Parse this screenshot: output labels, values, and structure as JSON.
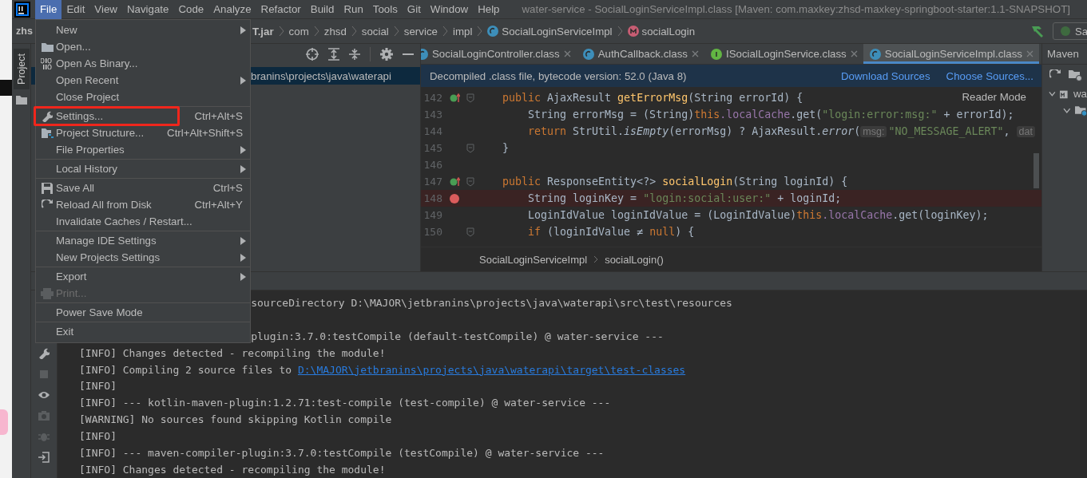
{
  "window": {
    "title": "water-service - SocialLoginServiceImpl.class [Maven: com.maxkey:zhsd-maxkey-springboot-starter:1.1-SNAPSHOT]"
  },
  "menu_bar": [
    {
      "label": "File",
      "selected": true
    },
    {
      "label": "Edit",
      "selected": false
    },
    {
      "label": "View",
      "selected": false
    },
    {
      "label": "Navigate",
      "selected": false
    },
    {
      "label": "Code",
      "selected": false
    },
    {
      "label": "Analyze",
      "selected": false
    },
    {
      "label": "Refactor",
      "selected": false
    },
    {
      "label": "Build",
      "selected": false
    },
    {
      "label": "Run",
      "selected": false
    },
    {
      "label": "Tools",
      "selected": false
    },
    {
      "label": "Git",
      "selected": false
    },
    {
      "label": "Window",
      "selected": false
    },
    {
      "label": "Help",
      "selected": false
    }
  ],
  "file_menu": {
    "groups": [
      [
        {
          "label": "New",
          "kind": "plain",
          "submenu": true,
          "disabled": false,
          "highlighted": false
        },
        {
          "label": "Open...",
          "kind": "folder",
          "submenu": false,
          "disabled": false,
          "highlighted": false
        },
        {
          "label": "Open As Binary...",
          "kind": "binary",
          "submenu": false,
          "disabled": false,
          "highlighted": false
        },
        {
          "label": "Open Recent",
          "kind": "plain",
          "submenu": true,
          "disabled": false,
          "highlighted": false
        },
        {
          "label": "Close Project",
          "kind": "plain",
          "submenu": false,
          "disabled": false,
          "highlighted": false
        }
      ],
      [
        {
          "label": "Settings...",
          "kind": "wrench",
          "shortcut": "Ctrl+Alt+S",
          "submenu": false,
          "disabled": false,
          "highlighted": true
        },
        {
          "label": "Project Structure...",
          "kind": "structure",
          "shortcut": "Ctrl+Alt+Shift+S",
          "submenu": false,
          "disabled": false,
          "highlighted": false
        },
        {
          "label": "File Properties",
          "kind": "plain",
          "submenu": true,
          "disabled": false,
          "highlighted": false
        }
      ],
      [
        {
          "label": "Local History",
          "kind": "plain",
          "submenu": true,
          "disabled": false,
          "highlighted": false
        }
      ],
      [
        {
          "label": "Save All",
          "kind": "save",
          "shortcut": "Ctrl+S",
          "submenu": false,
          "disabled": false,
          "highlighted": false
        },
        {
          "label": "Reload All from Disk",
          "kind": "reload",
          "shortcut": "Ctrl+Alt+Y",
          "submenu": false,
          "disabled": false,
          "highlighted": false
        },
        {
          "label": "Invalidate Caches / Restart...",
          "kind": "plain",
          "submenu": false,
          "disabled": false,
          "highlighted": false
        }
      ],
      [
        {
          "label": "Manage IDE Settings",
          "kind": "plain",
          "submenu": true,
          "disabled": false,
          "highlighted": false
        },
        {
          "label": "New Projects Settings",
          "kind": "plain",
          "submenu": true,
          "disabled": false,
          "highlighted": false
        }
      ],
      [
        {
          "label": "Export",
          "kind": "plain",
          "submenu": true,
          "disabled": false,
          "highlighted": false
        },
        {
          "label": "Print...",
          "kind": "print",
          "submenu": false,
          "disabled": true,
          "highlighted": false
        }
      ],
      [
        {
          "label": "Power Save Mode",
          "kind": "plain",
          "submenu": false,
          "disabled": false,
          "highlighted": false
        }
      ],
      [
        {
          "label": "Exit",
          "kind": "plain",
          "submenu": false,
          "disabled": false,
          "highlighted": false
        }
      ]
    ]
  },
  "navigation_bar": {
    "crumbs": [
      {
        "label": "zhs",
        "kind": "project"
      },
      {
        "label": "T.jar",
        "kind": "jar"
      },
      {
        "label": "com",
        "kind": "package"
      },
      {
        "label": "zhsd",
        "kind": "package"
      },
      {
        "label": "social",
        "kind": "package"
      },
      {
        "label": "service",
        "kind": "package"
      },
      {
        "label": "impl",
        "kind": "package"
      },
      {
        "label": "SocialLoginServiceImpl",
        "kind": "class"
      },
      {
        "label": "socialLogin",
        "kind": "method"
      }
    ],
    "run_button": "Sa"
  },
  "sidebar": {
    "tab": "Project"
  },
  "project_panel": {
    "selected_row": "branins\\projects\\java\\waterapi"
  },
  "editor": {
    "tabs": [
      {
        "label": "SocialLoginController.class",
        "kind": "class",
        "selected": false
      },
      {
        "label": "AuthCallback.class",
        "kind": "class",
        "selected": false
      },
      {
        "label": "ISocialLoginService.class",
        "kind": "interface",
        "selected": false
      },
      {
        "label": "SocialLoginServiceImpl.class",
        "kind": "class",
        "selected": true
      }
    ],
    "banner": {
      "text": "Decompiled .class file, bytecode version: 52.0 (Java 8)",
      "links": [
        "Download Sources",
        "Choose Sources..."
      ]
    },
    "reader_mode": "Reader Mode",
    "lines": [
      {
        "number": "142",
        "override": true,
        "fold": true,
        "breakpoint": false,
        "tokens": [
          {
            "kind": "keyword",
            "text": "public "
          },
          {
            "kind": "plain",
            "text": "AjaxResult "
          },
          {
            "kind": "decl",
            "text": "getErrorMsg"
          },
          {
            "kind": "plain",
            "text": "(String errorId) {"
          }
        ]
      },
      {
        "number": "143",
        "override": false,
        "fold": false,
        "breakpoint": false,
        "tokens": [
          {
            "kind": "plain",
            "text": "    String errorMsg = (String)"
          },
          {
            "kind": "keyword",
            "text": "this"
          },
          {
            "kind": "field",
            "text": ".localCache"
          },
          {
            "kind": "plain",
            "text": ".get("
          },
          {
            "kind": "string",
            "text": "\"login:error:msg:\""
          },
          {
            "kind": "plain",
            "text": " + errorId);"
          }
        ]
      },
      {
        "number": "144",
        "override": false,
        "fold": false,
        "breakpoint": false,
        "tokens": [
          {
            "kind": "keyword",
            "text": "    return "
          },
          {
            "kind": "plain",
            "text": "StrUtil."
          },
          {
            "kind": "italic",
            "text": "isEmpty"
          },
          {
            "kind": "plain",
            "text": "(errorMsg) ? AjaxResult."
          },
          {
            "kind": "italic",
            "text": "error"
          },
          {
            "kind": "plain",
            "text": "("
          },
          {
            "kind": "hint",
            "text": "msg:"
          },
          {
            "kind": "string",
            "text": "\"NO_MESSAGE_ALERT\""
          },
          {
            "kind": "plain",
            "text": ", "
          },
          {
            "kind": "hint",
            "text": "dat"
          }
        ]
      },
      {
        "number": "145",
        "override": false,
        "fold": true,
        "breakpoint": false,
        "tokens": [
          {
            "kind": "plain",
            "text": "}"
          }
        ]
      },
      {
        "number": "146",
        "override": false,
        "fold": false,
        "breakpoint": false
      },
      {
        "number": "147",
        "override": true,
        "fold": true,
        "breakpoint": false,
        "tokens": [
          {
            "kind": "keyword",
            "text": "public "
          },
          {
            "kind": "plain",
            "text": "ResponseEntity<?> "
          },
          {
            "kind": "decl",
            "text": "socialLogin"
          },
          {
            "kind": "plain",
            "text": "(String loginId) {"
          }
        ]
      },
      {
        "number": "148",
        "override": false,
        "fold": false,
        "breakpoint": true,
        "tokens": [
          {
            "kind": "plain",
            "text": "    String loginKey = "
          },
          {
            "kind": "string",
            "text": "\"login:social:user:\""
          },
          {
            "kind": "plain",
            "text": " + loginId;"
          }
        ]
      },
      {
        "number": "149",
        "override": false,
        "fold": false,
        "breakpoint": false,
        "tokens": [
          {
            "kind": "plain",
            "text": "    LoginIdValue loginIdValue = (LoginIdValue)"
          },
          {
            "kind": "keyword",
            "text": "this"
          },
          {
            "kind": "field",
            "text": ".localCache"
          },
          {
            "kind": "plain",
            "text": ".get(loginKey);"
          }
        ]
      },
      {
        "number": "150",
        "override": false,
        "fold": true,
        "breakpoint": false,
        "tokens": [
          {
            "kind": "keyword",
            "text": "    if "
          },
          {
            "kind": "plain",
            "text": "(loginIdValue ≠ "
          },
          {
            "kind": "keyword",
            "text": "null"
          },
          {
            "kind": "plain",
            "text": ") {"
          }
        ]
      }
    ],
    "breadcrumbs": [
      "SocialLoginServiceImpl",
      "socialLogin()"
    ]
  },
  "maven_panel": {
    "title": "Maven",
    "tree": [
      {
        "label": "wa",
        "expanded": true,
        "children": [
          {
            "kind": "module",
            "expanded": true
          }
        ]
      }
    ]
  },
  "console": {
    "lines": [
      {
        "kind": "after_menu",
        "text": "sourceDirectory D:\\MAJOR\\jetbranins\\projects\\java\\waterapi\\src\\test\\resources"
      },
      {
        "kind": "after_menu_gap",
        "text": "plugin:3.7.0:testCompile (default-testCompile) @ water-service ---"
      },
      {
        "kind": "plain",
        "text": "[INFO] Changes detected - recompiling the module!"
      },
      {
        "kind": "plain",
        "text": "[INFO] Compiling 2 source files to ",
        "link": "D:\\MAJOR\\jetbranins\\projects\\java\\waterapi\\target\\test-classes"
      },
      {
        "kind": "plain",
        "text": "[INFO]"
      },
      {
        "kind": "plain",
        "text": "[INFO] --- kotlin-maven-plugin:1.2.71:test-compile (test-compile) @ water-service ---"
      },
      {
        "kind": "plain",
        "text": "[WARNING] No sources found skipping Kotlin compile"
      },
      {
        "kind": "plain",
        "text": "[INFO]"
      },
      {
        "kind": "plain",
        "text": "[INFO] --- maven-compiler-plugin:3.7.0:testCompile (testCompile) @ water-service ---"
      },
      {
        "kind": "plain",
        "text": "[INFO] Changes detected - recompiling the module!"
      }
    ]
  }
}
